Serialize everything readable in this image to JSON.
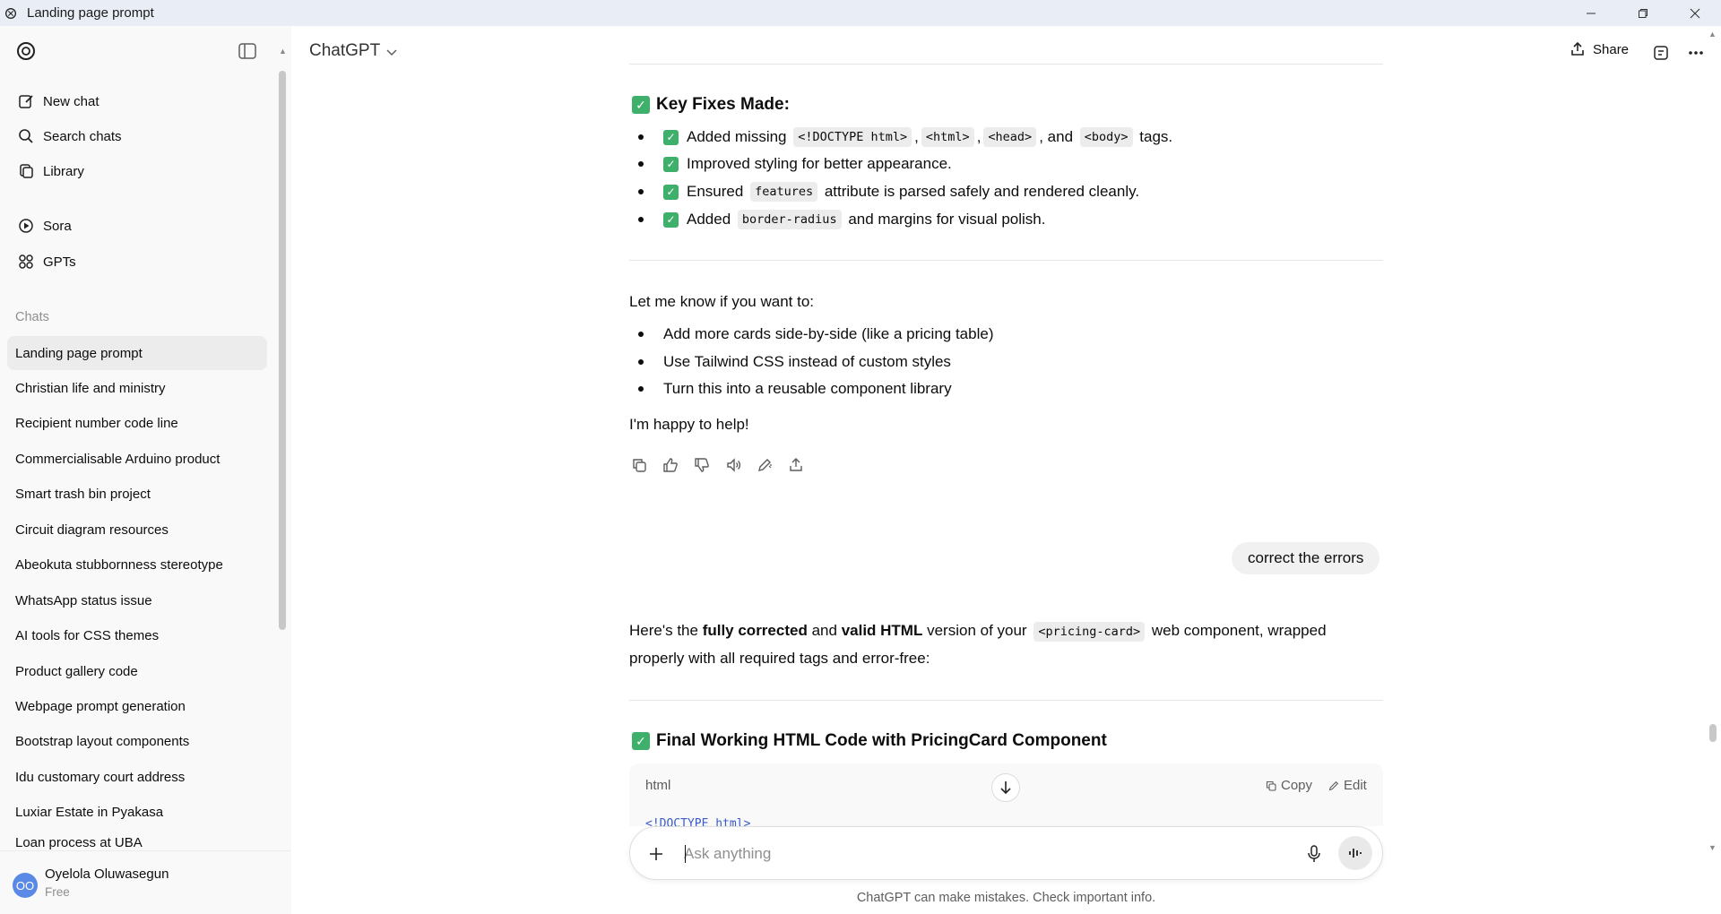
{
  "window": {
    "title": "Landing page prompt",
    "controls": [
      "minimize",
      "restore",
      "close"
    ]
  },
  "sidebar": {
    "nav": [
      {
        "label": "New chat",
        "icon": "new-chat-icon"
      },
      {
        "label": "Search chats",
        "icon": "search-icon"
      },
      {
        "label": "Library",
        "icon": "library-icon"
      }
    ],
    "apps": [
      {
        "label": "Sora",
        "icon": "sora-icon"
      },
      {
        "label": "GPTs",
        "icon": "gpts-icon"
      }
    ],
    "chats_heading": "Chats",
    "chats": [
      "Landing page prompt",
      "Christian life and ministry",
      "Recipient number code line",
      "Commercialisable Arduino product",
      "Smart trash bin project",
      "Circuit diagram resources",
      "Abeokuta stubbornness stereotype",
      "WhatsApp status issue",
      "AI tools for CSS themes",
      "Product gallery code",
      "Webpage prompt generation",
      "Bootstrap layout components",
      "Idu customary court address",
      "Luxiar Estate in Pyakasa",
      "Loan process at UBA"
    ],
    "active_chat_index": 0,
    "user": {
      "initials": "OO",
      "name": "Oyelola Oluwasegun",
      "plan": "Free"
    }
  },
  "header": {
    "model": "ChatGPT",
    "share_label": "Share"
  },
  "conversation": {
    "key_fixes_heading": "Key Fixes Made:",
    "key_fixes": {
      "item1": {
        "pre": "Added missing",
        "codes": [
          "<!DOCTYPE html>",
          "<html>",
          "<head>",
          "<body>"
        ],
        "and": "and",
        "post": "tags."
      },
      "item2": {
        "text": "Improved styling for better appearance."
      },
      "item3": {
        "pre": "Ensured",
        "code": "features",
        "post": "attribute is parsed safely and rendered cleanly."
      },
      "item4": {
        "pre": "Added",
        "code": "border-radius",
        "post": "and margins for visual polish."
      }
    },
    "let_me_know": "Let me know if you want to:",
    "options": [
      "Add more cards side-by-side (like a pricing table)",
      "Use Tailwind CSS instead of custom styles",
      "Turn this into a reusable component library"
    ],
    "closing": "I'm happy to help!",
    "user_message": "correct the errors",
    "reply": {
      "pre": "Here's the",
      "bold1": "fully corrected",
      "mid": "and",
      "bold2": "valid HTML",
      "mid2": "version of your",
      "code": "<pricing-card>",
      "post": "web component, wrapped",
      "line2": "properly with all required tags and error-free:"
    },
    "final_heading": "Final Working HTML Code with PricingCard Component",
    "code_block": {
      "lang": "html",
      "copy_label": "Copy",
      "edit_label": "Edit",
      "first_line": "<!DOCTYPE html>"
    }
  },
  "composer": {
    "placeholder": "Ask anything"
  },
  "disclaimer": "ChatGPT can make mistakes. Check important info.",
  "colors": {
    "check_green": "#3fb06b",
    "sidebar_bg": "#f9f9f9",
    "active_chat_bg": "#ececec",
    "avatar_blue": "#5b8ae6"
  }
}
